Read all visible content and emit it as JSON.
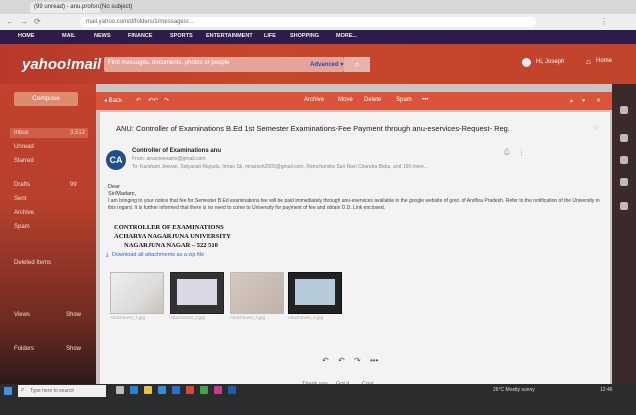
{
  "browser": {
    "tabs": [
      "(99 unread) - anu.proforda...",
      "(No subject)"
    ],
    "url": "mail.yahoo.com/d/folders/1/messages/..."
  },
  "yahoo_nav": [
    "HOME",
    "MAIL",
    "NEWS",
    "FINANCE",
    "SPORTS",
    "ENTERTAINMENT",
    "LIFE",
    "SHOPPING",
    "MORE..."
  ],
  "header": {
    "logo": "yahoo!mail",
    "search_placeholder": "Find messages, documents, photos or people",
    "advanced": "Advanced ▾",
    "user": "Hi, Joseph",
    "home": "Home"
  },
  "sidebar": {
    "compose": "Compose",
    "items": [
      {
        "label": "Inbox",
        "count": "3,512"
      },
      {
        "label": "Unread",
        "count": ""
      },
      {
        "label": "Starred",
        "count": ""
      },
      {
        "label": "Drafts",
        "count": "99"
      },
      {
        "label": "Sent",
        "count": ""
      },
      {
        "label": "Archive",
        "count": ""
      },
      {
        "label": "Spam",
        "count": ""
      },
      {
        "label": "Deleted Items",
        "count": ""
      }
    ],
    "sections": [
      "Views",
      "Folders"
    ],
    "section_actions": [
      "Show",
      "Show"
    ]
  },
  "toolbar": {
    "back": "◂ Back",
    "archive": "Archive",
    "move": "Move",
    "delete": "Delete",
    "spam": "Spam",
    "more": "•••"
  },
  "message": {
    "subject": "ANU: Controller of Examinations B.Ed 1st Semester Examinations-Fee Payment through anu-eservices-Request- Reg.",
    "avatar": "CA",
    "sender": "Controller of Examinations anu",
    "from": "From: anucoeexams@gmail.com",
    "to": "To: Karsham Jeevan, Satyavati Rayudu, Imran Sk, mnaresh2003@gmail.com, Ramchandra Suri Ravi Chandra Babu, and 150 more...",
    "greeting": "Dear",
    "salutation": "Sir/Madam,",
    "body": "I am bringing to your notice that fee for Semester B.Ed examinations fee will be paid immediately through anu-eservices available in the google website of govt. of Andhra Pradesh. Refer to the notification of the University in this regard. It is further informed that there is no need to come to University for payment of fee and obtain D.D. Link enclosed.",
    "signature": [
      "CONTROLLER OF EXAMINATIONS",
      "ACHARYA NAGARJUNA UNIVERSITY",
      "NAGARJUNA NAGAR – 522 510"
    ],
    "download": "Download all attachments as a zip file",
    "attachments": [
      "Attachment_1.jpg",
      "Attachment_2.jpg",
      "Attachment_3.jpg",
      "Attachment_4.jpg"
    ],
    "reply_suggestions": [
      "Thank you",
      "Got it",
      "Cool"
    ]
  },
  "taskbar": {
    "search": "Type here to search",
    "weather": "26°C Mostly sunny",
    "time": "12:46"
  },
  "colors": {
    "header_accent": "#c0432c",
    "nav_bg": "#2e1b4a",
    "link": "#2b6ad6"
  }
}
